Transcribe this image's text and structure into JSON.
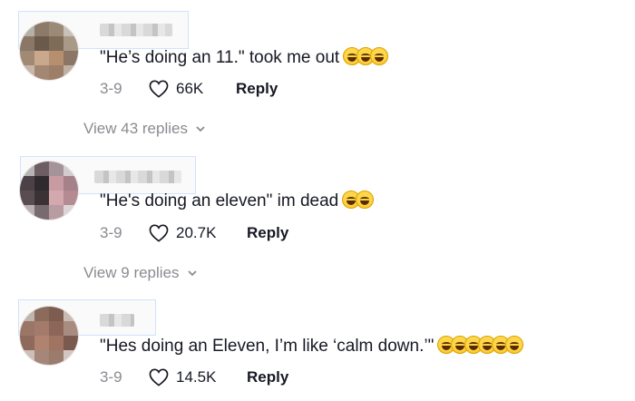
{
  "comments": [
    {
      "text": "\"He’s doing an 11.\" took me out",
      "emoji_count": 3,
      "date": "3-9",
      "likes": "66K",
      "reply_label": "Reply",
      "view_replies": "View 43 replies"
    },
    {
      "text": "\"He's doing an eleven\" im dead",
      "emoji_count": 2,
      "date": "3-9",
      "likes": "20.7K",
      "reply_label": "Reply",
      "view_replies": "View 9 replies"
    },
    {
      "text": "\"Hes doing an Eleven, I’m like ‘calm down.’\"",
      "emoji_count": 6,
      "date": "3-9",
      "likes": "14.5K",
      "reply_label": "Reply"
    }
  ],
  "icons": {
    "like": "heart-outline-icon",
    "expand": "chevron-down-icon",
    "emoji": "face-with-tears-of-joy-icon"
  },
  "colors": {
    "text": "#161823",
    "muted": "#8a8b91",
    "background": "#ffffff"
  }
}
